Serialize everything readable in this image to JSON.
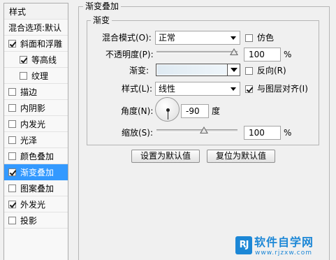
{
  "sidebar": {
    "header": "样式",
    "blend_default": "混合选项:默认",
    "items": [
      {
        "label": "斜面和浮雕",
        "checked": true
      },
      {
        "label": "等高线",
        "checked": true
      },
      {
        "label": "纹理",
        "checked": false
      },
      {
        "label": "描边",
        "checked": false
      },
      {
        "label": "内阴影",
        "checked": false
      },
      {
        "label": "内发光",
        "checked": false
      },
      {
        "label": "光泽",
        "checked": false
      },
      {
        "label": "颜色叠加",
        "checked": false
      },
      {
        "label": "渐变叠加",
        "checked": true
      },
      {
        "label": "图案叠加",
        "checked": false
      },
      {
        "label": "外发光",
        "checked": true
      },
      {
        "label": "投影",
        "checked": false
      }
    ]
  },
  "panel": {
    "outer_title": "渐变叠加",
    "inner_title": "渐变",
    "blend_mode_label": "混合模式(O):",
    "blend_mode_value": "正常",
    "dither_label": "仿色",
    "opacity_label": "不透明度(P):",
    "opacity_value": "100",
    "opacity_level": 1.0,
    "percent": "%",
    "gradient_label": "渐变:",
    "reverse_label": "反向(R)",
    "style_label": "样式(L):",
    "style_value": "线性",
    "align_label": "与图层对齐(I)",
    "angle_label": "角度(N):",
    "angle_value": "-90",
    "degree_unit": "度",
    "scale_label": "缩放(S):",
    "scale_value": "100",
    "scale_level": 0.5,
    "checks": {
      "dither": false,
      "reverse": false,
      "align": true
    },
    "colors": {
      "selection": "#3399ff",
      "gradient_start": "#dfeaf2",
      "gradient_end": "#eef5fa"
    }
  },
  "buttons": {
    "make_default": "设置为默认值",
    "reset_default": "复位为默认值"
  },
  "watermark": {
    "logo_text": "RJ",
    "title": "软件自学网",
    "url": "www.rjzxw.com"
  }
}
